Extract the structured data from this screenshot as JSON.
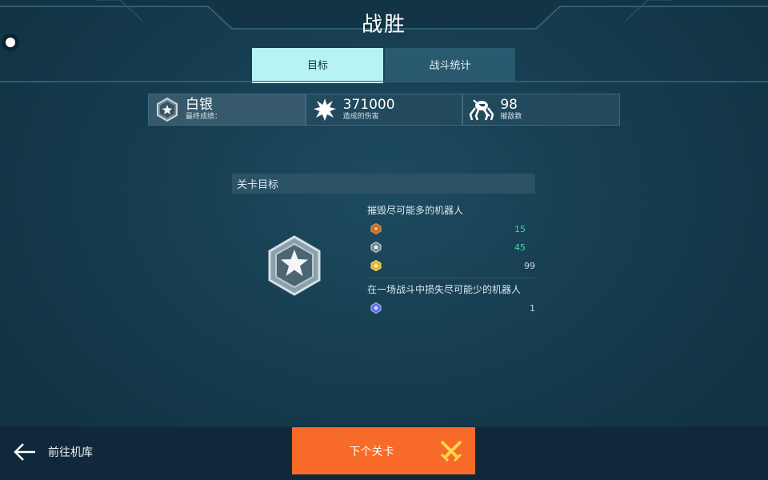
{
  "header": {
    "title": "战胜"
  },
  "tabs": [
    {
      "label": "目标",
      "active": true
    },
    {
      "label": "战斗统计",
      "active": false
    }
  ],
  "stats": {
    "rank": {
      "value": "白银",
      "label": "最终成绩：",
      "icon": "silver-rank-icon"
    },
    "damage": {
      "value": "371000",
      "label": "造成的伤害",
      "icon": "explosion-icon"
    },
    "kills": {
      "value": "98",
      "label": "摧敌数",
      "icon": "robot-kill-icon"
    }
  },
  "objectives": {
    "header": "关卡目标",
    "groups": [
      {
        "title": "摧毁尽可能多的机器人",
        "rows": [
          {
            "medal": "bronze-medal-icon",
            "color": "#c9691f",
            "value": "15"
          },
          {
            "medal": "silver-medal-icon",
            "color": "#9fb3bf",
            "value": "45"
          },
          {
            "medal": "gold-medal-icon",
            "color": "#e8b42c",
            "value": "99"
          }
        ]
      },
      {
        "title": "在一场战斗中损失尽可能少的机器人",
        "rows": [
          {
            "medal": "platinum-medal-icon",
            "color": "#5b6de0",
            "value": "1"
          }
        ]
      }
    ]
  },
  "footer": {
    "back_label": "前往机库",
    "next_label": "下个关卡"
  },
  "colors": {
    "accent_orange": "#f76a28",
    "tab_active": "#b5f3f6",
    "value_green": "#46d6a8"
  }
}
